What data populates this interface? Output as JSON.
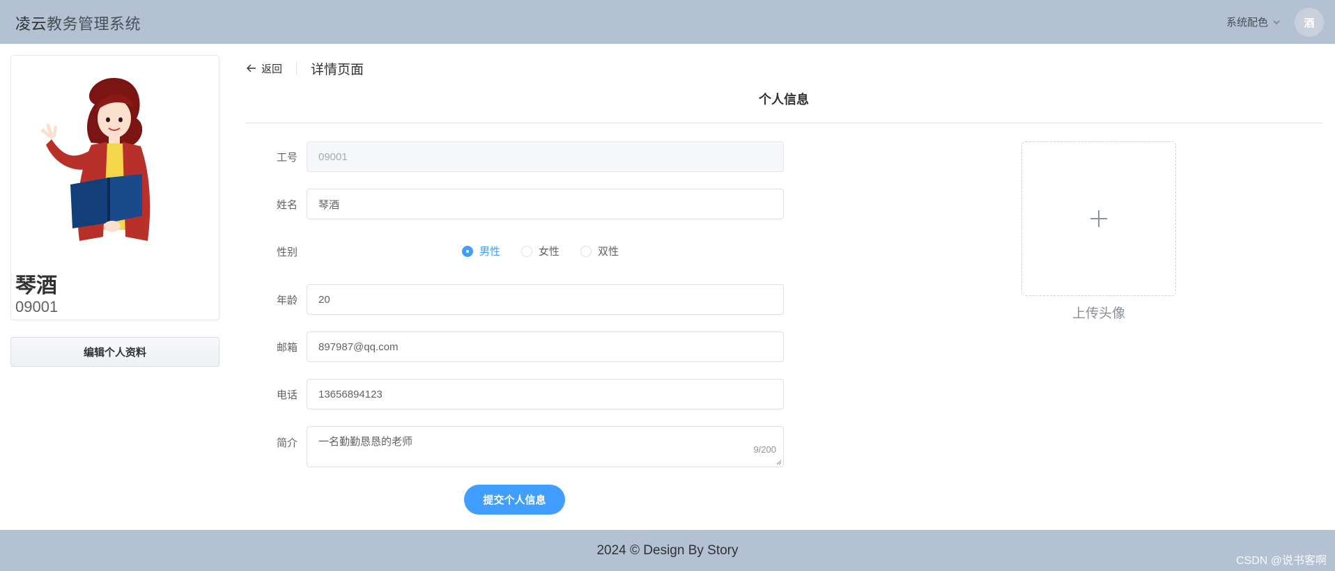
{
  "header": {
    "logo_prefix": "凌云",
    "logo_rest": "教务管理系统",
    "theme_menu_label": "系统配色",
    "avatar_text": "酒"
  },
  "profile": {
    "name": "琴酒",
    "id": "09001",
    "edit_button": "编辑个人资料"
  },
  "page_header": {
    "back_label": "返回",
    "title": "详情页面"
  },
  "section_title": "个人信息",
  "form": {
    "work_id": {
      "label": "工号",
      "value": "09001"
    },
    "name": {
      "label": "姓名",
      "value": "琴酒"
    },
    "gender": {
      "label": "性别",
      "options": [
        "男性",
        "女性",
        "双性"
      ],
      "selected": "男性"
    },
    "age": {
      "label": "年龄",
      "value": "20"
    },
    "email": {
      "label": "邮箱",
      "value": "897987@qq.com"
    },
    "phone": {
      "label": "电话",
      "value": "13656894123"
    },
    "bio": {
      "label": "简介",
      "value": "一名勤勤恳恳的老师",
      "counter": "9/200"
    },
    "submit_label": "提交个人信息"
  },
  "upload": {
    "label": "上传头像"
  },
  "footer": {
    "text": "2024 © Design By Story"
  },
  "watermark": "CSDN @说书客啊",
  "colors": {
    "header_bg": "#b4c1d3",
    "primary": "#409eff"
  }
}
